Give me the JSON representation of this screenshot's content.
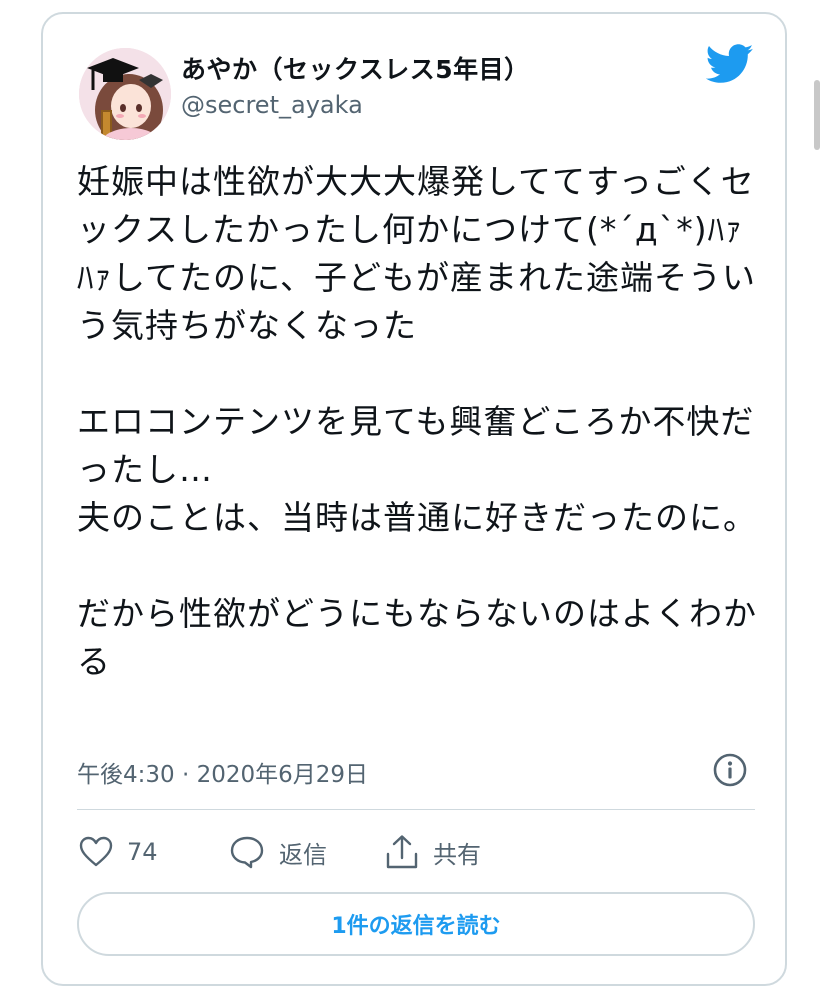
{
  "user": {
    "display_name": "あやか（セックスレス5年目）",
    "handle": "@secret_ayaka"
  },
  "tweet": {
    "paragraphs": [
      "妊娠中は性欲が大大大爆発しててすっごくセックスしたかったし何かにつけて(*´д`*)ﾊｧﾊｧしてたのに、子どもが産まれた途端そういう気持ちがなくなった",
      "エロコンテンツを見ても興奮どころか不快だったし…\n夫のことは、当時は普通に好きだったのに。",
      "だから性欲がどうにもならないのはよくわかる"
    ],
    "timestamp": "午後4:30 · 2020年6月29日"
  },
  "actions": {
    "like_count": "74",
    "reply_label": "返信",
    "share_label": "共有"
  },
  "read_replies_label": "1件の返信を読む",
  "icons": {
    "brand": "twitter-bird-icon",
    "info": "info-icon",
    "like": "heart-icon",
    "reply": "speech-bubble-icon",
    "share": "share-icon"
  },
  "colors": {
    "brand_blue": "#1d9bf0",
    "text": "#0f1419",
    "secondary_text": "#536471",
    "border": "#cfd9de"
  }
}
